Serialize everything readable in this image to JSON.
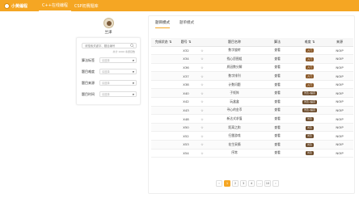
{
  "header": {
    "brand": "小黄编程",
    "nav": [
      "C++在线编程",
      "CSP初赛题库"
    ],
    "active_nav": 0
  },
  "profile": {
    "name": "兰泽"
  },
  "filters": {
    "search_placeholder": "请搜索关键字、题目编号",
    "search_hint": "共计 1000 条题目数",
    "rows": [
      {
        "label": "算法标签",
        "placeholder": "请选择"
      },
      {
        "label": "题目难度",
        "placeholder": "请选择"
      },
      {
        "label": "题目来源",
        "placeholder": "请选择"
      },
      {
        "label": "题目时间",
        "placeholder": "请选择"
      }
    ]
  },
  "tabs": [
    "题目模式",
    "题单模式"
  ],
  "table": {
    "headers": [
      "完成状态 ⇅",
      "题号 ⇅",
      "",
      "题目名称",
      "算法",
      "难度 ⇅",
      "来源"
    ],
    "rows": [
      {
        "id": "X32",
        "star": "☆",
        "name": "数字旋转",
        "algo": "查看",
        "diff": "入门",
        "src": "NOIP"
      },
      {
        "id": "X34",
        "star": "☆",
        "name": "找心愿图组",
        "algo": "查看",
        "diff": "入门",
        "src": "NOIP"
      },
      {
        "id": "X36",
        "star": "☆",
        "name": "质因数分解",
        "algo": "查看",
        "diff": "入门",
        "src": "NOIP"
      },
      {
        "id": "X37",
        "star": "☆",
        "name": "数字排列",
        "algo": "查看",
        "diff": "入门",
        "src": "NOIP"
      },
      {
        "id": "X38",
        "star": "☆",
        "name": "计数问题",
        "algo": "查看",
        "diff": "入门",
        "src": "NOIP"
      },
      {
        "id": "X40",
        "star": "☆",
        "name": "子矩阵",
        "algo": "查看",
        "diff": "普及-/提高",
        "src": "NOIP"
      },
      {
        "id": "X42",
        "star": "☆",
        "name": "玩盒盒",
        "algo": "查看",
        "diff": "普及-/提高",
        "src": "NOIP"
      },
      {
        "id": "X43",
        "star": "☆",
        "name": "寻心的金币",
        "algo": "查看",
        "diff": "普及-/提高",
        "src": "NOIP"
      },
      {
        "id": "X48",
        "star": "☆",
        "name": "新达式求值",
        "algo": "查看",
        "diff": "普及",
        "src": "NOIP"
      },
      {
        "id": "X50",
        "star": "☆",
        "name": "距离之和",
        "algo": "查看",
        "diff": "普及",
        "src": "NOIP"
      },
      {
        "id": "X52",
        "star": "☆",
        "name": "扫雷游戏",
        "algo": "查看",
        "diff": "普及",
        "src": "NOIP"
      },
      {
        "id": "X53",
        "star": "☆",
        "name": "花生采摘",
        "algo": "查看",
        "diff": "普及",
        "src": "NOIP"
      },
      {
        "id": "X54",
        "star": "☆",
        "name": "序常",
        "algo": "查看",
        "diff": "普及",
        "src": "NOIP"
      }
    ]
  },
  "pagination": {
    "pages": [
      "‹",
      "1",
      "2",
      "3",
      "4",
      "…",
      "10",
      "›"
    ],
    "active": "1"
  },
  "colors": {
    "accent": "#f5a623",
    "badge_intro": "#8b5a2b",
    "badge_mid": "#6b4a2a"
  }
}
